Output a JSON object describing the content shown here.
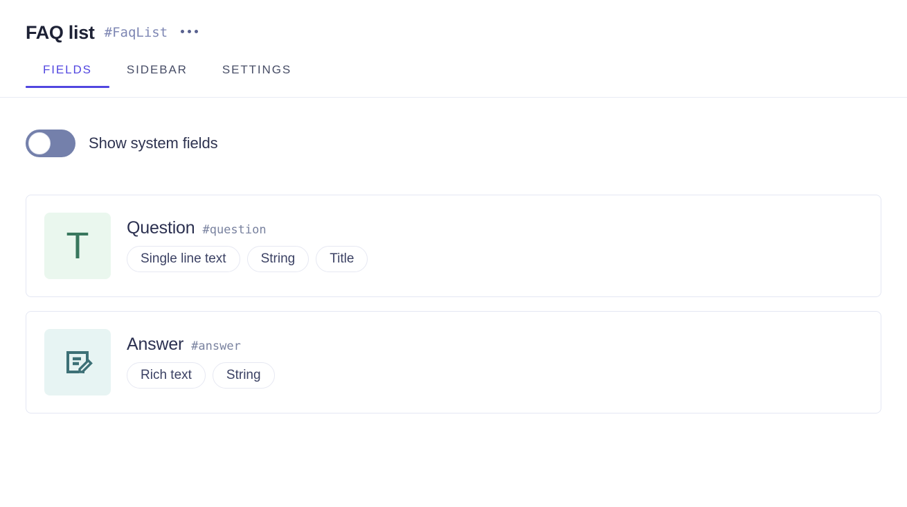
{
  "header": {
    "title": "FAQ list",
    "slug": "#FaqList",
    "menu_icon": "kebab-menu-icon"
  },
  "tabs": [
    {
      "label": "FIELDS",
      "active": true
    },
    {
      "label": "SIDEBAR",
      "active": false
    },
    {
      "label": "SETTINGS",
      "active": false
    }
  ],
  "toggle": {
    "label": "Show system fields",
    "state": "off",
    "track_color": "#7480ab",
    "knob_color": "#ffffff"
  },
  "fields": [
    {
      "name": "Question",
      "slug": "#question",
      "icon": "text-letter-t-icon",
      "icon_bg": "#eaf7ee",
      "icon_color": "#38775d",
      "tags": [
        "Single line text",
        "String",
        "Title"
      ]
    },
    {
      "name": "Answer",
      "slug": "#answer",
      "icon": "rich-text-document-edit-icon",
      "icon_bg": "#e7f4f3",
      "icon_color": "#3d7076",
      "tags": [
        "Rich text",
        "String"
      ]
    }
  ],
  "theme": {
    "accent": "#5146e0",
    "text": "#2e3350",
    "muted": "#79829f",
    "border": "#e4e7f3"
  }
}
